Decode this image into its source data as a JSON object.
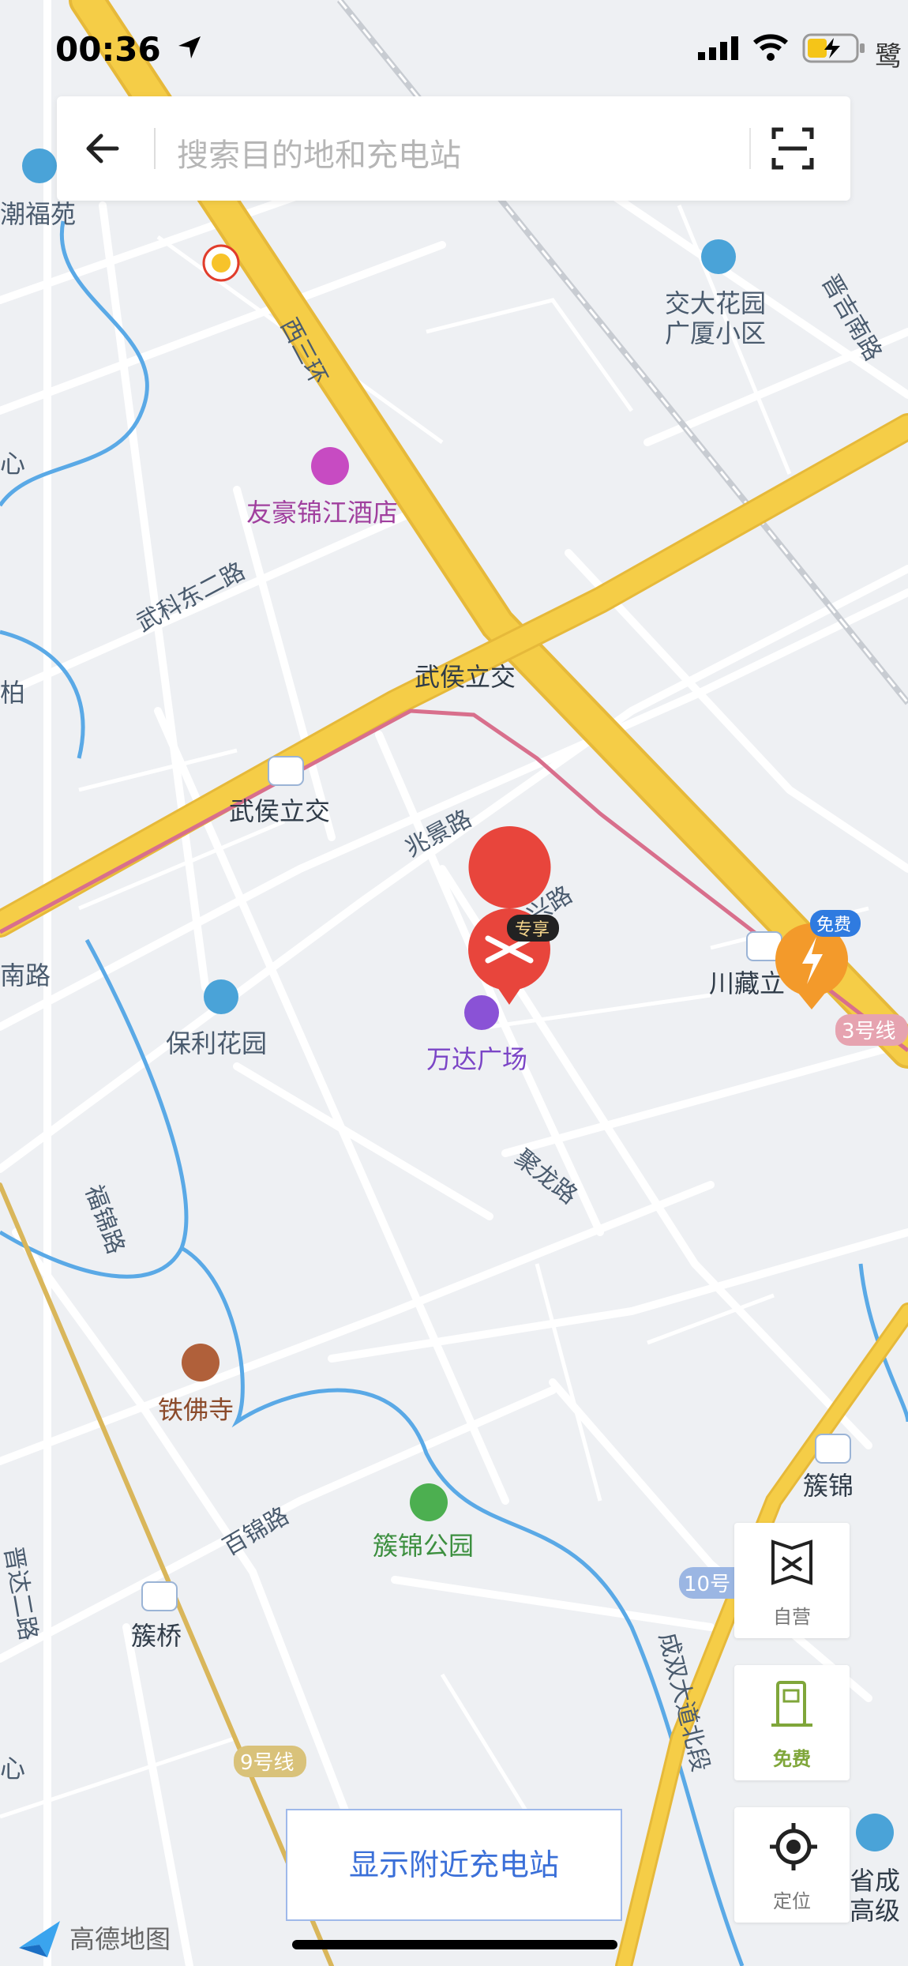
{
  "status_bar": {
    "time": "00:36",
    "carrier_hint": "鹭"
  },
  "search": {
    "placeholder": "搜索目的地和充电站"
  },
  "map": {
    "road_labels": [
      {
        "text": "西三环"
      },
      {
        "text": "武科东二路"
      },
      {
        "text": "兆景路"
      },
      {
        "text": "兴路"
      },
      {
        "text": "聚龙路"
      },
      {
        "text": "福锦路"
      },
      {
        "text": "百锦路"
      },
      {
        "text": "成双大道北段"
      },
      {
        "text": "晋吉南路"
      },
      {
        "text": "晋达二路"
      }
    ],
    "poi_labels": {
      "hotel": "友豪锦江酒店",
      "garden_top": "交大花园\n广厦小区",
      "garden_top_line1": "交大花园",
      "garden_top_line2": "广厦小区",
      "wuhou_interchange": "武侯立交",
      "wuhou_station": "武侯立交",
      "wanda": "万达广场",
      "poly_garden": "保利花园",
      "tiefo_temple": "铁佛寺",
      "cujin_park": "簇锦公园",
      "cujin_station_left": "簇桥",
      "cujin_station_right": "簇锦",
      "chuanzang": "川藏立",
      "left_edge_1": "潮福苑",
      "left_edge_2": "心",
      "left_edge_3": "柏",
      "left_edge_4": "南路",
      "left_edge_5": "心",
      "bottom_right": "省成\n高级",
      "bottom_right_l1": "省成",
      "bottom_right_l2": "高级"
    },
    "metro_labels": {
      "line3": "3号线",
      "line9": "9号线",
      "line10": "10号"
    },
    "markers": {
      "exclusive_badge": "专享",
      "free_badge": "免费"
    }
  },
  "side_buttons": {
    "self_operated": "自营",
    "free": "免费",
    "locate": "定位"
  },
  "nearby_button": "显示附近充电站",
  "watermark": "高德地图",
  "colors": {
    "highway": "#f5cd47",
    "road": "#ffffff",
    "water": "#5aa9e6",
    "accent_blue": "#3a6fd8",
    "xpeng_red": "#e8453c",
    "charge_orange": "#f39a2b",
    "free_green": "#7fa63a"
  }
}
